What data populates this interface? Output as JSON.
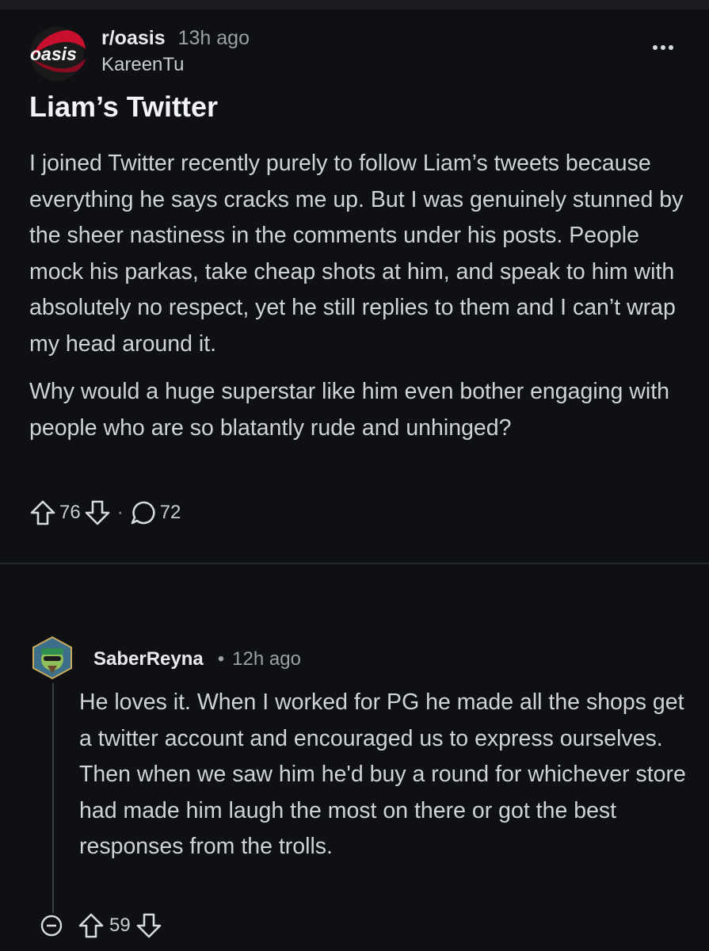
{
  "post": {
    "subreddit": "r/oasis",
    "time": "13h ago",
    "author": "KareenTu",
    "logo_text": "oasis",
    "title": "Liam’s Twitter",
    "paragraphs": [
      "I joined Twitter recently purely to follow Liam’s tweets because everything he says cracks me up. But I was genuinely stunned by the sheer nastiness in the comments under his posts. People mock his parkas, take cheap shots at him, and speak to him with absolutely no respect, yet he still replies to them and I can’t wrap my head around it.",
      "Why would a huge superstar like him even bother engaging with people who are so blatantly rude and unhinged?"
    ],
    "upvotes": "76",
    "comments": "72",
    "dot": "·"
  },
  "comment": {
    "author": "SaberReyna",
    "dot": "•",
    "time": "12h ago",
    "text": "He loves it. When I worked for PG he made all the shops get a twitter account and encouraged us to express ourselves. Then when we saw him he'd buy a round for whichever store had made him laugh the most on there or got the best responses from the trolls.",
    "upvotes": "59"
  },
  "icons": {
    "overflow": "more-horizontal-icon",
    "upvote": "arrow-up-icon",
    "downvote": "arrow-down-icon",
    "comment": "speech-bubble-icon",
    "collapse": "minus-circle-icon"
  },
  "colors": {
    "background": "#0e1013",
    "text": "#cfd3d7",
    "muted": "#9aa0a6",
    "logo_red": "#c8102e"
  }
}
